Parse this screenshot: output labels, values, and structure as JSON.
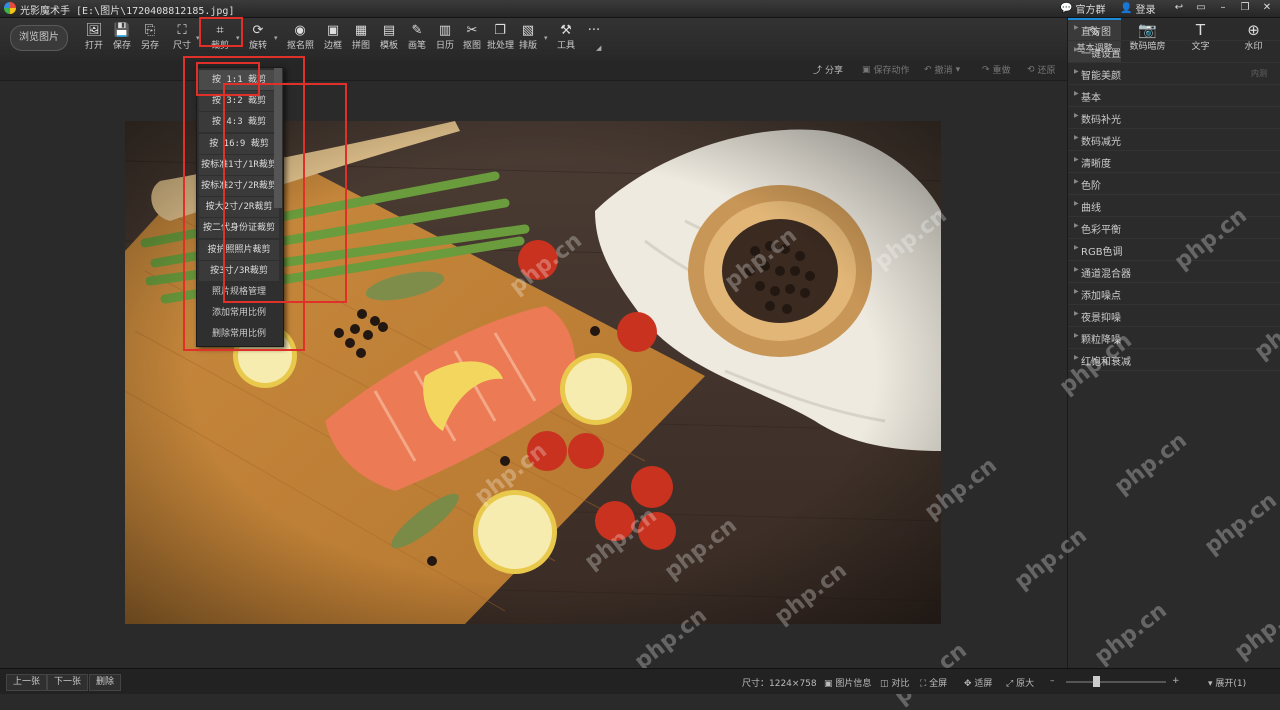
{
  "titlebar": {
    "app_name": "光影魔术手",
    "file_path": "[E:\\图片\\1720408812185.jpg]",
    "guanfangqun": "官方群",
    "login": "登录",
    "win_buttons": [
      "↩",
      "▭",
      "–",
      "❐",
      "✕"
    ]
  },
  "toolbar": {
    "browse": "浏览图片",
    "tools": [
      {
        "label": "打开",
        "icon": "🖼"
      },
      {
        "label": "保存",
        "icon": "💾"
      },
      {
        "label": "另存",
        "icon": "⎘"
      },
      {
        "label": "尺寸",
        "icon": "⛶"
      },
      {
        "label": "裁剪",
        "icon": "⌗"
      },
      {
        "label": "旋转",
        "icon": "⟳"
      },
      {
        "label": "抠名照",
        "icon": "◉"
      },
      {
        "label": "边框",
        "icon": "▣"
      },
      {
        "label": "拼图",
        "icon": "▦"
      },
      {
        "label": "模板",
        "icon": "▤"
      },
      {
        "label": "画笔",
        "icon": "✎"
      },
      {
        "label": "日历",
        "icon": "▥"
      },
      {
        "label": "抠图",
        "icon": "✂"
      },
      {
        "label": "批处理",
        "icon": "❐"
      },
      {
        "label": "排版",
        "icon": "▧"
      },
      {
        "label": "工具",
        "icon": "⚒"
      },
      {
        "label": "",
        "icon": "···"
      }
    ]
  },
  "secondary": {
    "share": "分享",
    "save_action": "保存动作",
    "undo": "撤消",
    "redo": "重做",
    "restore": "还原"
  },
  "crop_menu": {
    "items": [
      "按 1:1 裁剪",
      "按 3:2 裁剪",
      "按 4:3 裁剪",
      "按 16:9 裁剪",
      "按标准1寸/1R裁剪",
      "按标准2寸/2R裁剪",
      "按大2寸/2R裁剪",
      "按二代身份证裁剪",
      "按护照照片裁剪",
      "按3寸/3R裁剪",
      "照片规格管理",
      "添加常用比例",
      "删除常用比例"
    ]
  },
  "right_panel": {
    "tabs": [
      {
        "label": "基本调整",
        "icon": "✎"
      },
      {
        "label": "数码暗房",
        "icon": "📷"
      },
      {
        "label": "文字",
        "icon": "T"
      },
      {
        "label": "水印",
        "icon": "⊕"
      }
    ],
    "items": [
      "直方图",
      "一键设置",
      "智能美颜",
      "基本",
      "数码补光",
      "数码减光",
      "清晰度",
      "色阶",
      "曲线",
      "色彩平衡",
      "RGB色调",
      "通道混合器",
      "添加噪点",
      "夜景抑噪",
      "颗粒降噪",
      "红饱和衰减"
    ],
    "smart_sub": "内测"
  },
  "statusbar": {
    "prev": "上一张",
    "next": "下一张",
    "delete": "删除",
    "size": "尺寸：1224×758",
    "info": "图片信息",
    "compare": "对比",
    "fullscreen": "全屏",
    "fit": "适屏",
    "original": "原大",
    "expand": "展开(1)",
    "zoom_minus": "–",
    "zoom_plus": "+"
  },
  "watermark": "php.cn",
  "colors": {
    "accent": "#1c8ad8",
    "highlight": "#e0302a"
  }
}
